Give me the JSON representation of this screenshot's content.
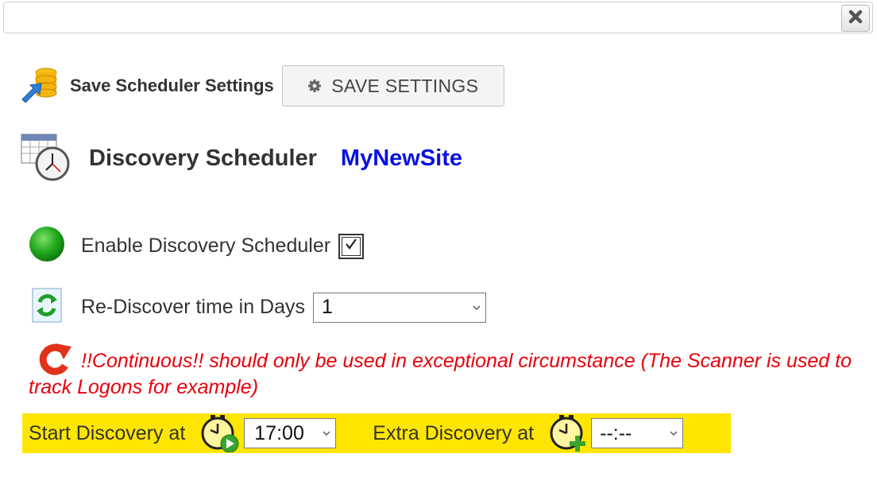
{
  "dialog": {
    "close_icon": "close-icon",
    "close_glyph": "✖"
  },
  "save": {
    "label": "Save Scheduler Settings",
    "button_label": "SAVE SETTINGS",
    "icon": "database-save-icon",
    "button_icon": "gear-icon"
  },
  "header": {
    "title": "Discovery Scheduler",
    "site_name": "MyNewSite",
    "icon": "calendar-clock-icon",
    "site_color": "#0a12e0"
  },
  "enable": {
    "label": "Enable Discovery Scheduler",
    "checked": true,
    "status_icon": "green-status-icon",
    "status_color": "#22a81e"
  },
  "rediscover": {
    "label": "Re-Discover time in Days",
    "value": "1",
    "icon": "refresh-icon"
  },
  "warning": {
    "text": "!!Continuous!! should only be used in exceptional circumstance (The Scanner is used to track Logons for example)",
    "icon": "redo-arrow-icon",
    "color": "#e8000b"
  },
  "schedule": {
    "start_label": "Start Discovery at",
    "start_value": "17:00",
    "start_icon": "clock-play-icon",
    "extra_label": "Extra Discovery at",
    "extra_value": "--:--",
    "extra_icon": "clock-add-icon",
    "highlight_color": "#ffe600"
  }
}
